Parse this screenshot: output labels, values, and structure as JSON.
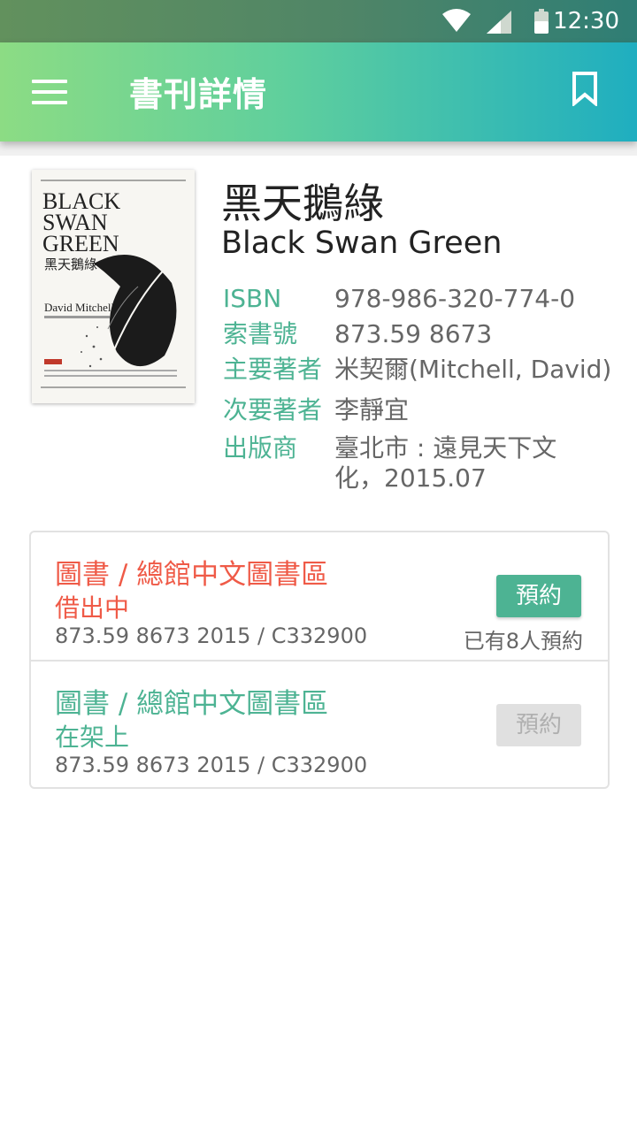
{
  "status_bar": {
    "time": "12:30"
  },
  "app_bar": {
    "title": "書刊詳情"
  },
  "book": {
    "cover_alt": "Black Swan Green cover",
    "title_zh": "黑天鵝綠",
    "title_en": "Black Swan Green",
    "meta": [
      {
        "label": "ISBN",
        "value": "978-986-320-774-0"
      },
      {
        "label": "索書號",
        "value": "873.59 8673"
      },
      {
        "label": "主要著者",
        "value": "米契爾(Mitchell, David)"
      },
      {
        "label": "次要著者",
        "value": "李靜宜"
      },
      {
        "label": "出版商",
        "value": "臺北市 : 遠見天下文化，2015.07"
      }
    ]
  },
  "holdings": [
    {
      "location": "圖書 / 總館中文圖書區",
      "status": "借出中",
      "call_number": "873.59 8673 2015 / C332900",
      "reserve_label": "預約",
      "reserve_enabled": true,
      "queue_text": "已有8人預約"
    },
    {
      "location": "圖書 / 總館中文圖書區",
      "status": "在架上",
      "call_number": "873.59 8673 2015 / C332900",
      "reserve_label": "預約",
      "reserve_enabled": false
    }
  ],
  "colors": {
    "accent_green": "#4db393",
    "status_red": "#ef5a47",
    "appbar_gradient_start": "#8cdc84",
    "appbar_gradient_end": "#1faec0"
  }
}
